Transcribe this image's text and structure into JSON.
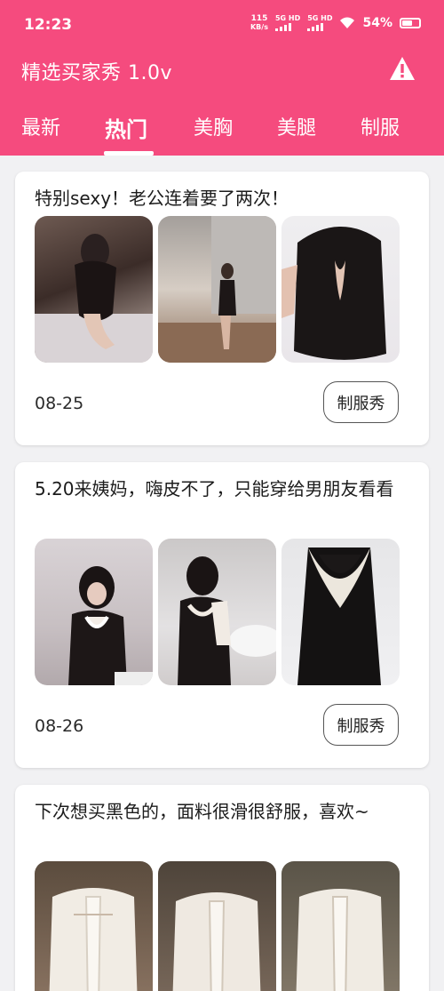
{
  "status_bar": {
    "time": "12:23",
    "net_speed_value": "115",
    "net_speed_unit": "KB/s",
    "sim1": "5G HD",
    "sim2": "5G HD",
    "battery_percent": "54%",
    "battery_level": 0.54
  },
  "app_bar": {
    "title": "精选买家秀 1.0v",
    "action_icon": "warning-icon"
  },
  "tabs": [
    {
      "label": "最新",
      "active": false
    },
    {
      "label": "热门",
      "active": true
    },
    {
      "label": "美胸",
      "active": false
    },
    {
      "label": "美腿",
      "active": false
    },
    {
      "label": "制服",
      "active": false
    }
  ],
  "posts": [
    {
      "title": "特别sexy！老公连着要了两次！",
      "date": "08-25",
      "tag": "制服秀",
      "images": [
        "lingerie-photo",
        "lingerie-photo",
        "lingerie-photo"
      ]
    },
    {
      "title": "5.20来姨妈，嗨皮不了，只能穿给男朋友看看",
      "date": "08-26",
      "tag": "制服秀",
      "images": [
        "lingerie-photo",
        "lingerie-photo",
        "lingerie-photo"
      ]
    },
    {
      "title": "下次想买黑色的，面料很滑很舒服，喜欢~",
      "date": "",
      "tag": "",
      "images": [
        "lingerie-photo",
        "lingerie-photo",
        "lingerie-photo"
      ]
    }
  ],
  "colors": {
    "brand": "#f54b7e",
    "background": "#f1f1f3"
  }
}
